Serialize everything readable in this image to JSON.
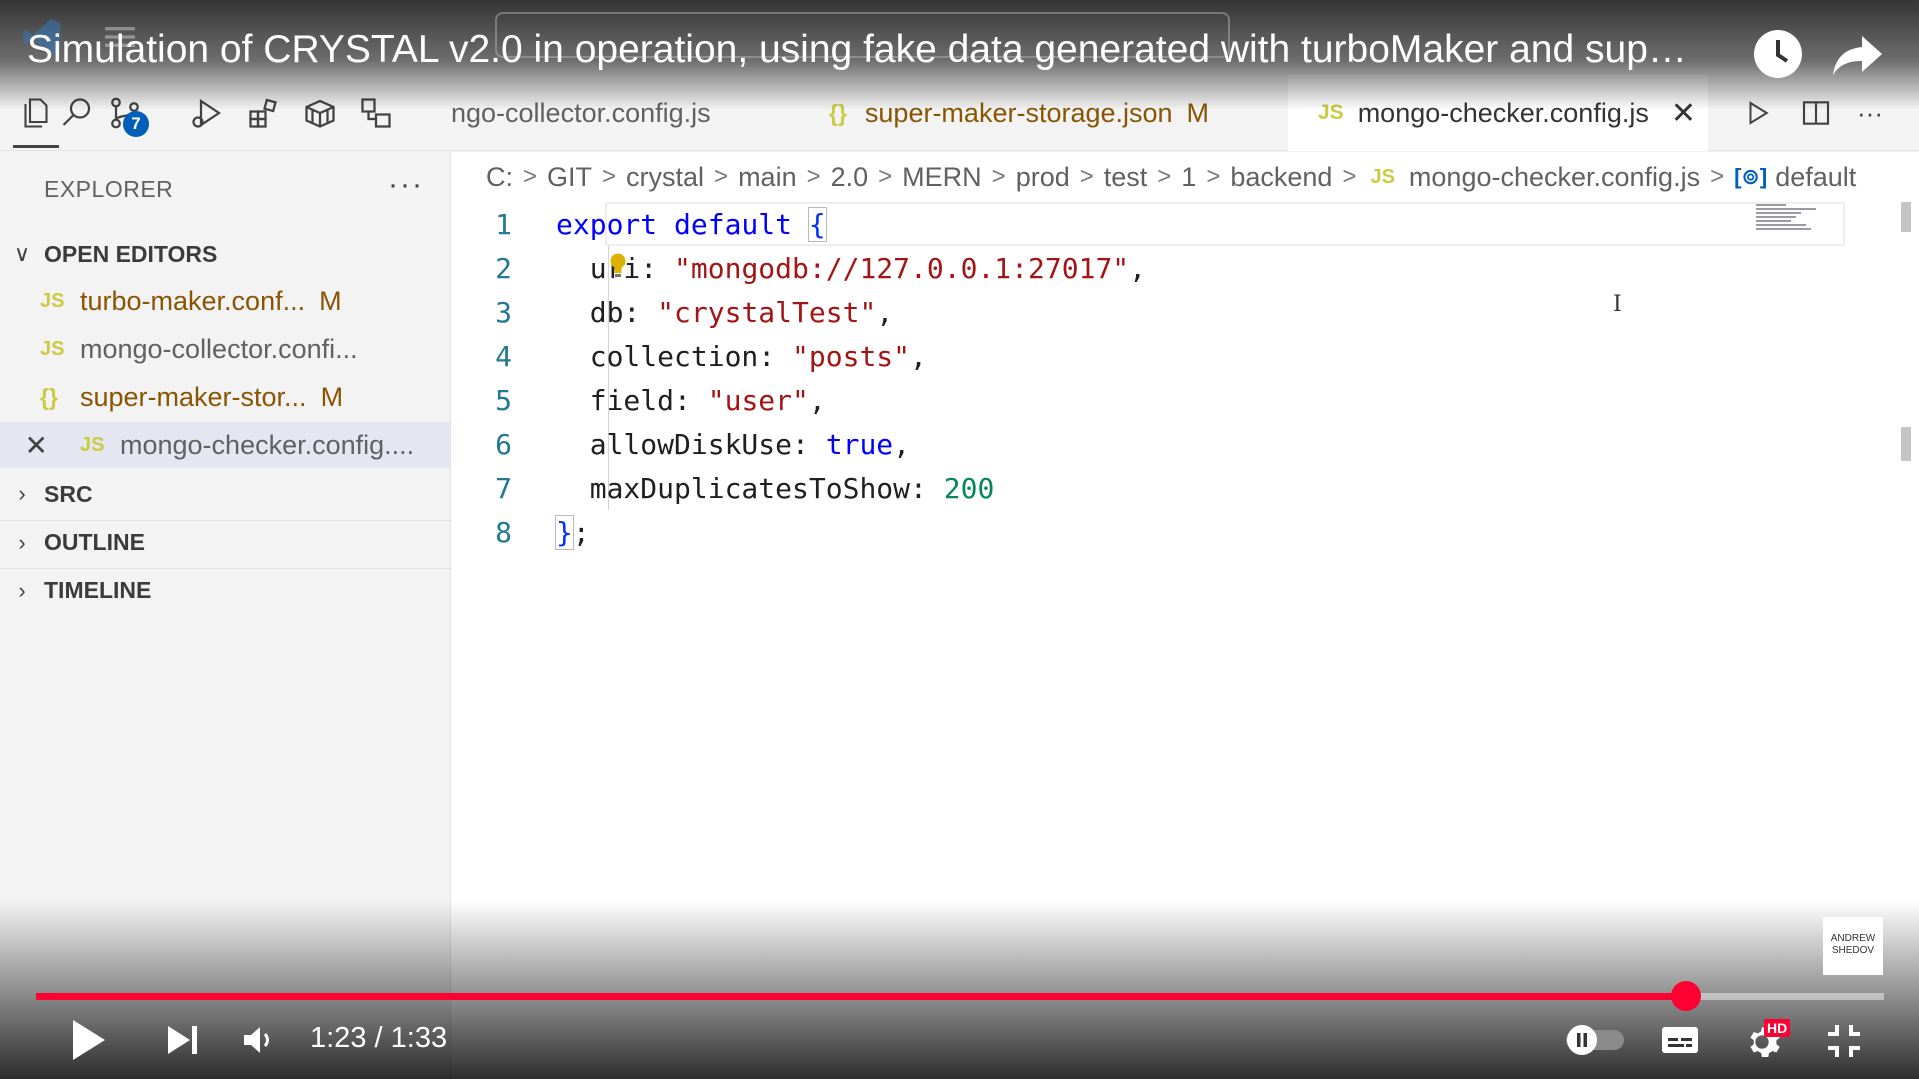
{
  "video": {
    "title": "Simulation of CRYSTAL v2.0 in operation, using fake data generated with turboMaker and sup…",
    "time_current": "1:23",
    "time_separator": "/",
    "time_total": "1:33",
    "progress": 0.893,
    "hd_badge": "HD",
    "watermark": "ANDREW SHEDOV"
  },
  "activity_bar": {
    "icons": [
      "explorer-icon",
      "search-icon",
      "source-control-icon",
      "run-debug-icon",
      "extensions-icon",
      "package-icon",
      "remote-icon"
    ],
    "source_control_badge": "7"
  },
  "tabs": [
    {
      "label": "ngo-collector.config.js",
      "icon": "js",
      "modified": ""
    },
    {
      "label": "super-maker-storage.json",
      "icon": "json",
      "modified": "M"
    },
    {
      "label": "mongo-checker.config.js",
      "icon": "js",
      "active": true,
      "close": "✕"
    }
  ],
  "tab_icons": {
    "js": "JS",
    "json": "{}"
  },
  "breadcrumb": [
    "C:",
    "GIT",
    "crystal",
    "main",
    "2.0",
    "MERN",
    "prod",
    "test",
    "1",
    "backend",
    "mongo-checker.config.js",
    "default"
  ],
  "sidebar": {
    "header": "EXPLORER",
    "more": "···",
    "open_editors_label": "OPEN EDITORS",
    "open_editors": [
      {
        "name": "turbo-maker.conf...",
        "icon": "JS",
        "modified": "M"
      },
      {
        "name": "mongo-collector.confi...",
        "icon": "JS",
        "modified": ""
      },
      {
        "name": "super-maker-stor...",
        "icon": "{}",
        "modified": "M"
      },
      {
        "name": "mongo-checker.config....",
        "icon": "JS",
        "modified": "",
        "close": "✕"
      }
    ],
    "sections": [
      "SRC",
      "OUTLINE",
      "TIMELINE"
    ]
  },
  "editor": {
    "line_numbers": [
      "1",
      "2",
      "3",
      "4",
      "5",
      "6",
      "7",
      "8"
    ],
    "code": {
      "l1_kw": "export default",
      "l1_brace": "{",
      "l2_key": "uri: ",
      "l2_val": "\"mongodb://127.0.0.1:27017\"",
      "l3_key": "db: ",
      "l3_val": "\"crystalTest\"",
      "l4_key": "collection: ",
      "l4_val": "\"posts\"",
      "l5_key": "field: ",
      "l5_val": "\"user\"",
      "l6_key": "allowDiskUse: ",
      "l6_val": "true",
      "l7_key": "maxDuplicatesToShow: ",
      "l7_val": "200",
      "l8_brace": "}",
      "comma": ",",
      "semicolon": ";"
    }
  },
  "colors": {
    "accent_blue": "#005fb8",
    "keyword": "#0000ff",
    "string": "#a31515",
    "number": "#098658",
    "modified": "#895503",
    "progress_red": "#ff0033"
  }
}
